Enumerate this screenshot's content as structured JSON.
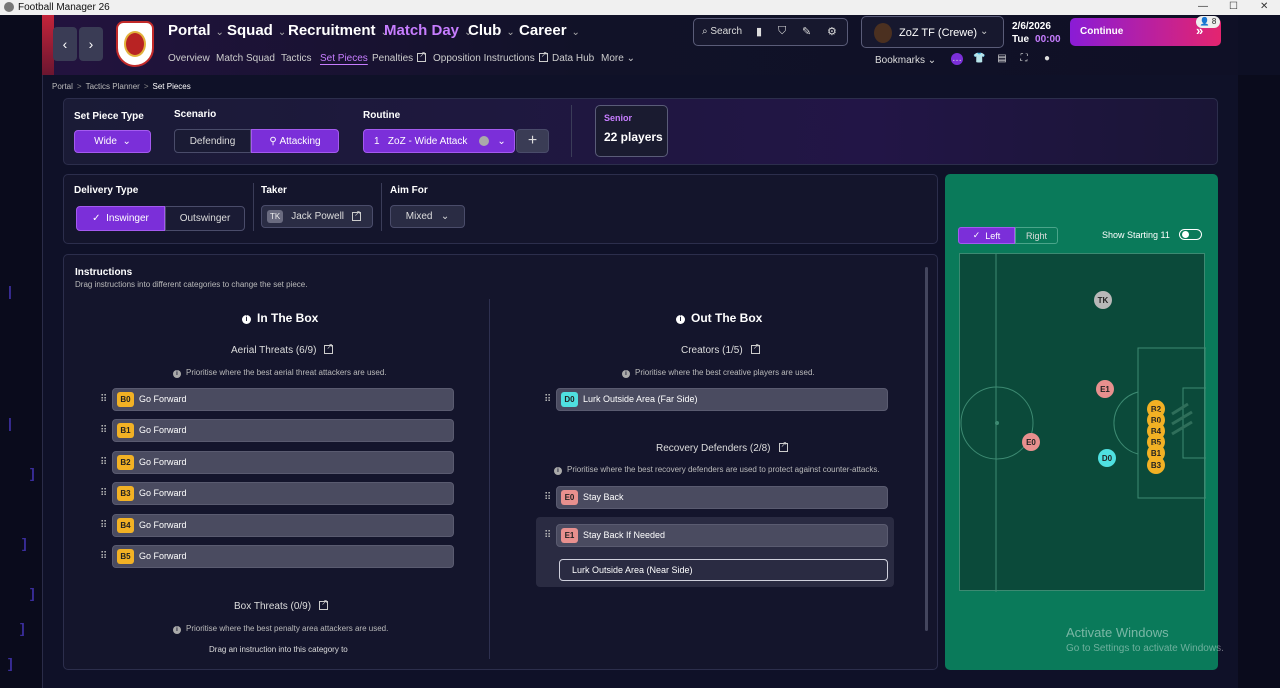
{
  "window": {
    "title": "Football Manager 26"
  },
  "nav": {
    "main": [
      {
        "label": "Portal"
      },
      {
        "label": "Squad"
      },
      {
        "label": "Recruitment"
      },
      {
        "label": "Match Day"
      },
      {
        "label": "Club"
      },
      {
        "label": "Career"
      }
    ],
    "sub": [
      "Overview",
      "Match Squad",
      "Tactics",
      "Set Pieces",
      "Penalties",
      "Opposition Instructions",
      "Data Hub",
      "More"
    ]
  },
  "header": {
    "search": "Search",
    "profile": "ZoZ TF (Crewe)",
    "date": "2/6/2026",
    "day": "Tue",
    "time": "00:00",
    "continue": "Continue",
    "notifications": "8",
    "bookmarks": "Bookmarks"
  },
  "breadcrumb": [
    "Portal",
    "Tactics Planner",
    "Set Pieces"
  ],
  "setpiece": {
    "type_label": "Set Piece Type",
    "type_value": "Wide",
    "scenario_label": "Scenario",
    "scenario_options": [
      "Defending",
      "Attacking"
    ],
    "routine_label": "Routine",
    "routine_num": "1",
    "routine_name": "ZoZ - Wide Attack",
    "squad_label": "Senior",
    "squad_count": "22 players"
  },
  "delivery": {
    "label": "Delivery Type",
    "options": [
      "Inswinger",
      "Outswinger"
    ],
    "taker_label": "Taker",
    "taker_initials": "TK",
    "taker_name": "Jack Powell",
    "aim_label": "Aim For",
    "aim_value": "Mixed"
  },
  "instructions": {
    "title": "Instructions",
    "subtitle": "Drag instructions into different categories to change the set piece.",
    "in_box": {
      "title": "In The Box",
      "aerial": {
        "label": "Aerial Threats (6/9)",
        "hint": "Prioritise where the best aerial threat attackers are used.",
        "items": [
          {
            "tag": "B0",
            "text": "Go Forward"
          },
          {
            "tag": "B1",
            "text": "Go Forward"
          },
          {
            "tag": "B2",
            "text": "Go Forward"
          },
          {
            "tag": "B3",
            "text": "Go Forward"
          },
          {
            "tag": "B4",
            "text": "Go Forward"
          },
          {
            "tag": "B5",
            "text": "Go Forward"
          }
        ]
      },
      "box": {
        "label": "Box Threats (0/9)",
        "hint": "Prioritise where the best penalty area attackers are used.",
        "empty": "Drag an instruction into this category to"
      }
    },
    "out_box": {
      "title": "Out The Box",
      "creators": {
        "label": "Creators (1/5)",
        "hint": "Prioritise where the best creative players are used.",
        "items": [
          {
            "tag": "D0",
            "text": "Lurk Outside Area (Far Side)"
          }
        ]
      },
      "recovery": {
        "label": "Recovery Defenders (2/8)",
        "hint": "Prioritise where the best recovery defenders are used to protect against counter-attacks.",
        "items": [
          {
            "tag": "E0",
            "text": "Stay Back"
          },
          {
            "tag": "E1",
            "text": "Stay Back If Needed"
          }
        ],
        "option": "Lurk Outside Area (Near Side)"
      }
    }
  },
  "pitch": {
    "side_options": [
      "Left",
      "Right"
    ],
    "show_starting": "Show Starting 11",
    "players": [
      {
        "tag": "TK",
        "color": "#b8b8b8"
      },
      {
        "tag": "E1",
        "color": "#e8908e"
      },
      {
        "tag": "E0",
        "color": "#e8908e"
      },
      {
        "tag": "D0",
        "color": "#4fe0e0"
      },
      {
        "tag": "B2",
        "color": "#f2b124"
      },
      {
        "tag": "B0",
        "color": "#f2b124"
      },
      {
        "tag": "B4",
        "color": "#f2b124"
      },
      {
        "tag": "B5",
        "color": "#f2b124"
      },
      {
        "tag": "B1",
        "color": "#f2b124"
      },
      {
        "tag": "B3",
        "color": "#f2b124"
      }
    ]
  },
  "watermark": {
    "line1": "Activate Windows",
    "line2": "Go to Settings to activate Windows."
  },
  "colors": {
    "accent": "#7b2fd9",
    "aerial_tag": "#f2b124",
    "creator_tag": "#4fe0e0",
    "recovery_tag": "#e8908e",
    "pitch": "#0a7a5a"
  }
}
